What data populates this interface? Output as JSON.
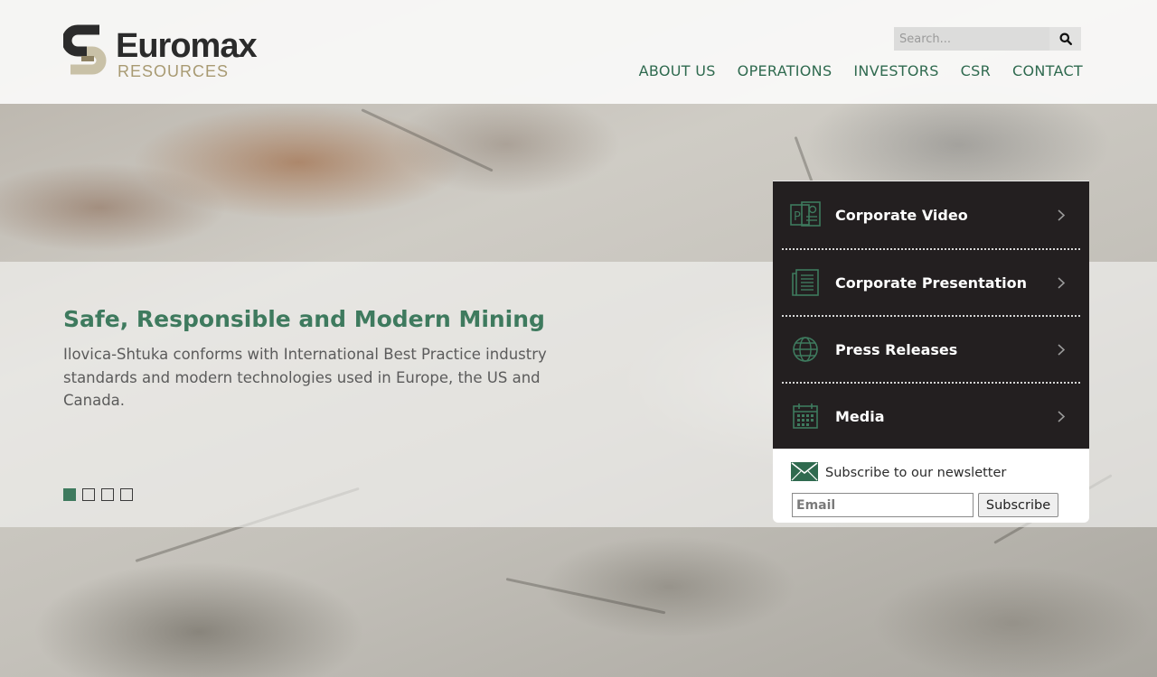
{
  "brand": {
    "name": "Euromax",
    "sub": "RESOURCES",
    "colors": {
      "dark": "#2b2b2b",
      "gold": "#a89a72",
      "green": "#3e7a5e"
    }
  },
  "search": {
    "placeholder": "Search...",
    "icon": "search-icon"
  },
  "nav": {
    "items": [
      "ABOUT US",
      "OPERATIONS",
      "INVESTORS",
      "CSR",
      "CONTACT"
    ]
  },
  "hero": {
    "title": "Safe, Responsible and Modern Mining",
    "text": "Ilovica-Shtuka conforms with International Best Practice industry standards and modern technologies used in Europe, the US and Canada.",
    "slides": 4,
    "active_slide": 1
  },
  "panel": {
    "items": [
      {
        "label": "Corporate Video",
        "icon": "powerpoint-icon"
      },
      {
        "label": "Corporate Presentation",
        "icon": "document-icon"
      },
      {
        "label": "Press Releases",
        "icon": "globe-icon"
      },
      {
        "label": "Media",
        "icon": "calendar-icon"
      }
    ]
  },
  "newsletter": {
    "text": "Subscribe to our newsletter",
    "email_placeholder": "Email",
    "button": "Subscribe",
    "icon": "envelope-icon"
  }
}
